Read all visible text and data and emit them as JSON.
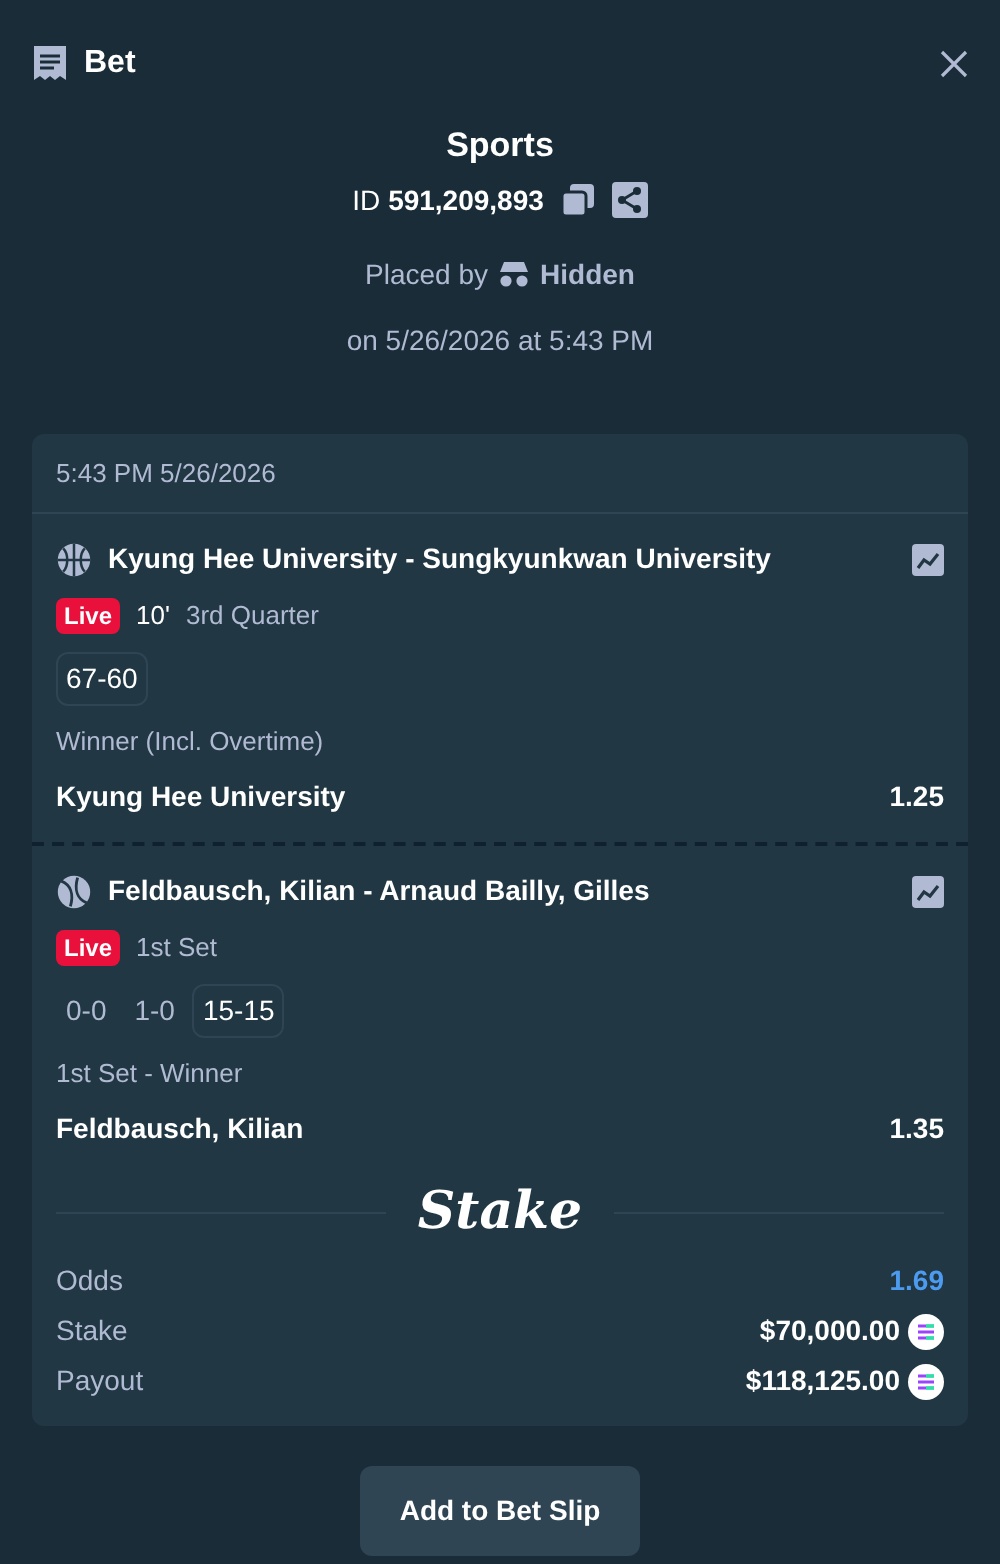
{
  "header": {
    "title": "Bet"
  },
  "summary": {
    "category": "Sports",
    "id_label": "ID",
    "id_value": "591,209,893",
    "placed_by": "Placed by",
    "user": "Hidden",
    "date": "on 5/26/2026 at 5:43 PM"
  },
  "card": {
    "timestamp": "5:43 PM 5/26/2026",
    "legs": [
      {
        "kind": "basketball",
        "event": "Kyung Hee University - Sungkyunkwan University",
        "live": "Live",
        "clock": "10'",
        "period": "3rd Quarter",
        "scores": [
          {
            "text": "67-60",
            "current": true
          }
        ],
        "market": "Winner (Incl. Overtime)",
        "selection": "Kyung Hee University",
        "odds": "1.25"
      },
      {
        "kind": "tennis",
        "event": "Feldbausch, Kilian - Arnaud Bailly, Gilles",
        "live": "Live",
        "period": "1st Set",
        "scores": [
          {
            "text": "0-0",
            "current": false
          },
          {
            "text": "1-0",
            "current": false
          },
          {
            "text": "15-15",
            "current": true
          }
        ],
        "market": "1st Set - Winner",
        "selection": "Feldbausch, Kilian",
        "odds": "1.35"
      }
    ],
    "brand": "Stake",
    "totals": [
      {
        "label": "Odds",
        "value": "1.69",
        "kind": "odds"
      },
      {
        "label": "Stake",
        "value": "$70,000.00",
        "kind": "amount"
      },
      {
        "label": "Payout",
        "value": "$118,125.00",
        "kind": "amount"
      }
    ]
  },
  "button": "Add to Bet Slip"
}
